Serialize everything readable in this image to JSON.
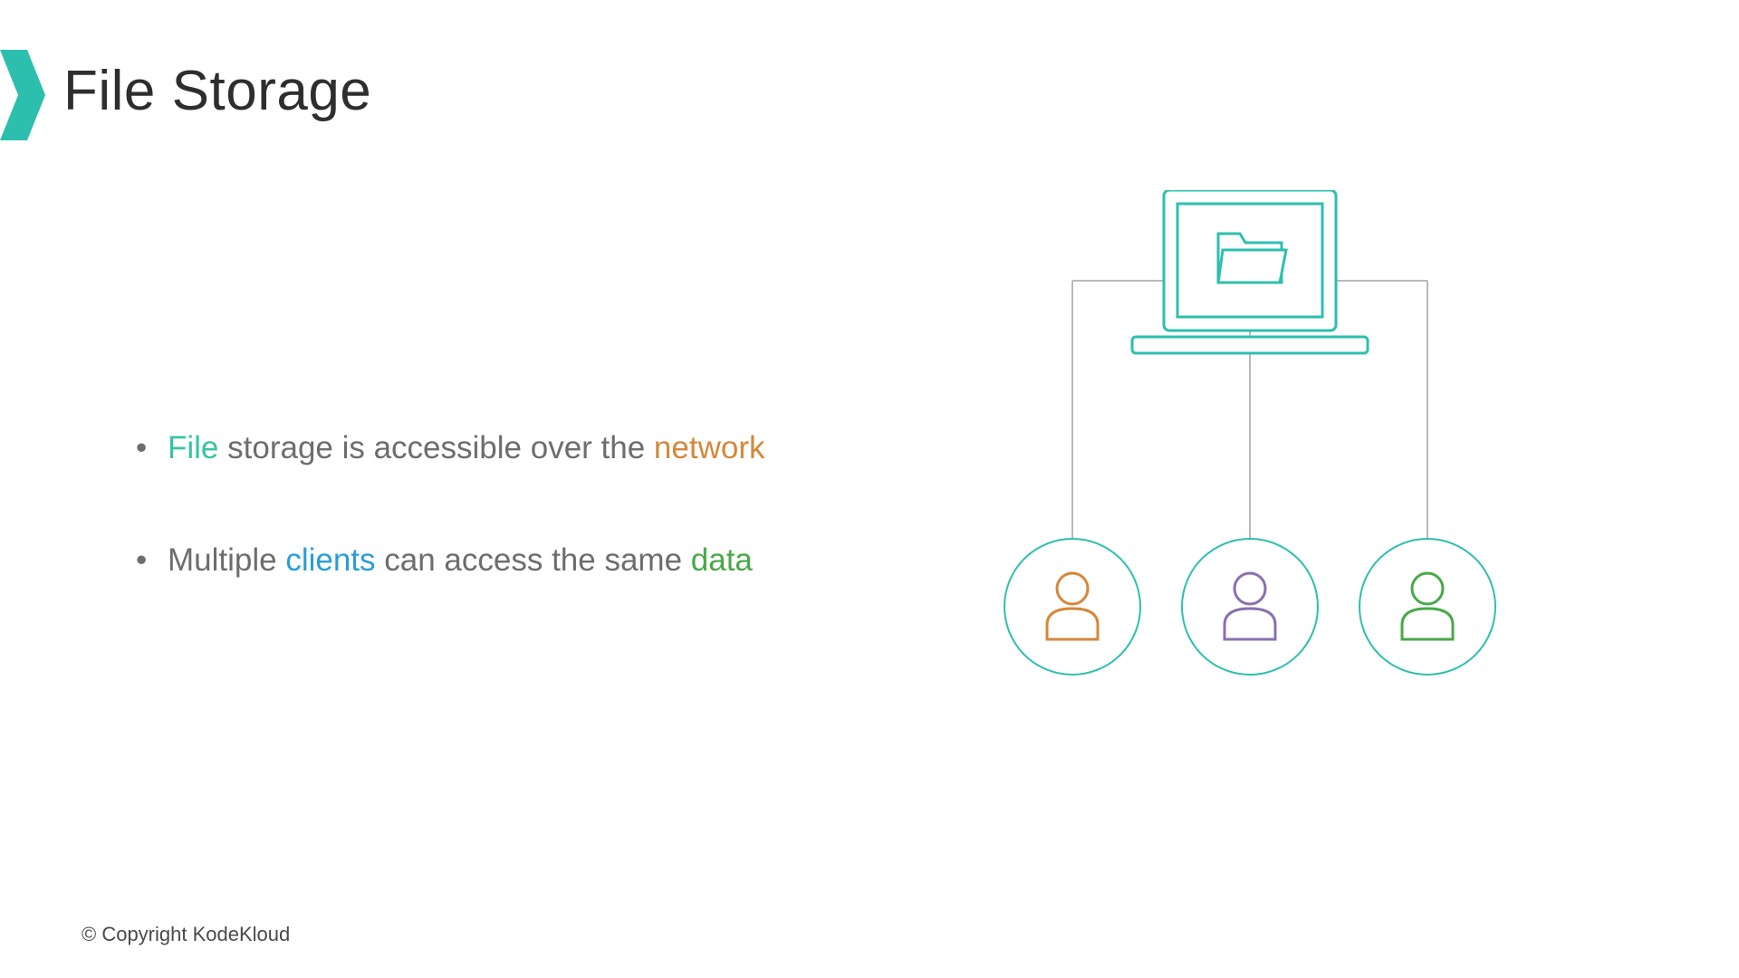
{
  "title": "File Storage",
  "bullets": [
    {
      "pre1": "File",
      "mid1": " storage is accessible over the ",
      "post1": "network"
    },
    {
      "pre2": "Multiple ",
      "mid2a": "clients",
      "mid2b": " can access the same ",
      "post2": "data"
    }
  ],
  "copyright": "© Copyright KodeKloud",
  "colors": {
    "file": "#34c4a4",
    "network": "#d6873a",
    "clients": "#2a9ed9",
    "data": "#4aa84a",
    "teal": "#2dbfae",
    "grey": "#b9b9b9"
  }
}
